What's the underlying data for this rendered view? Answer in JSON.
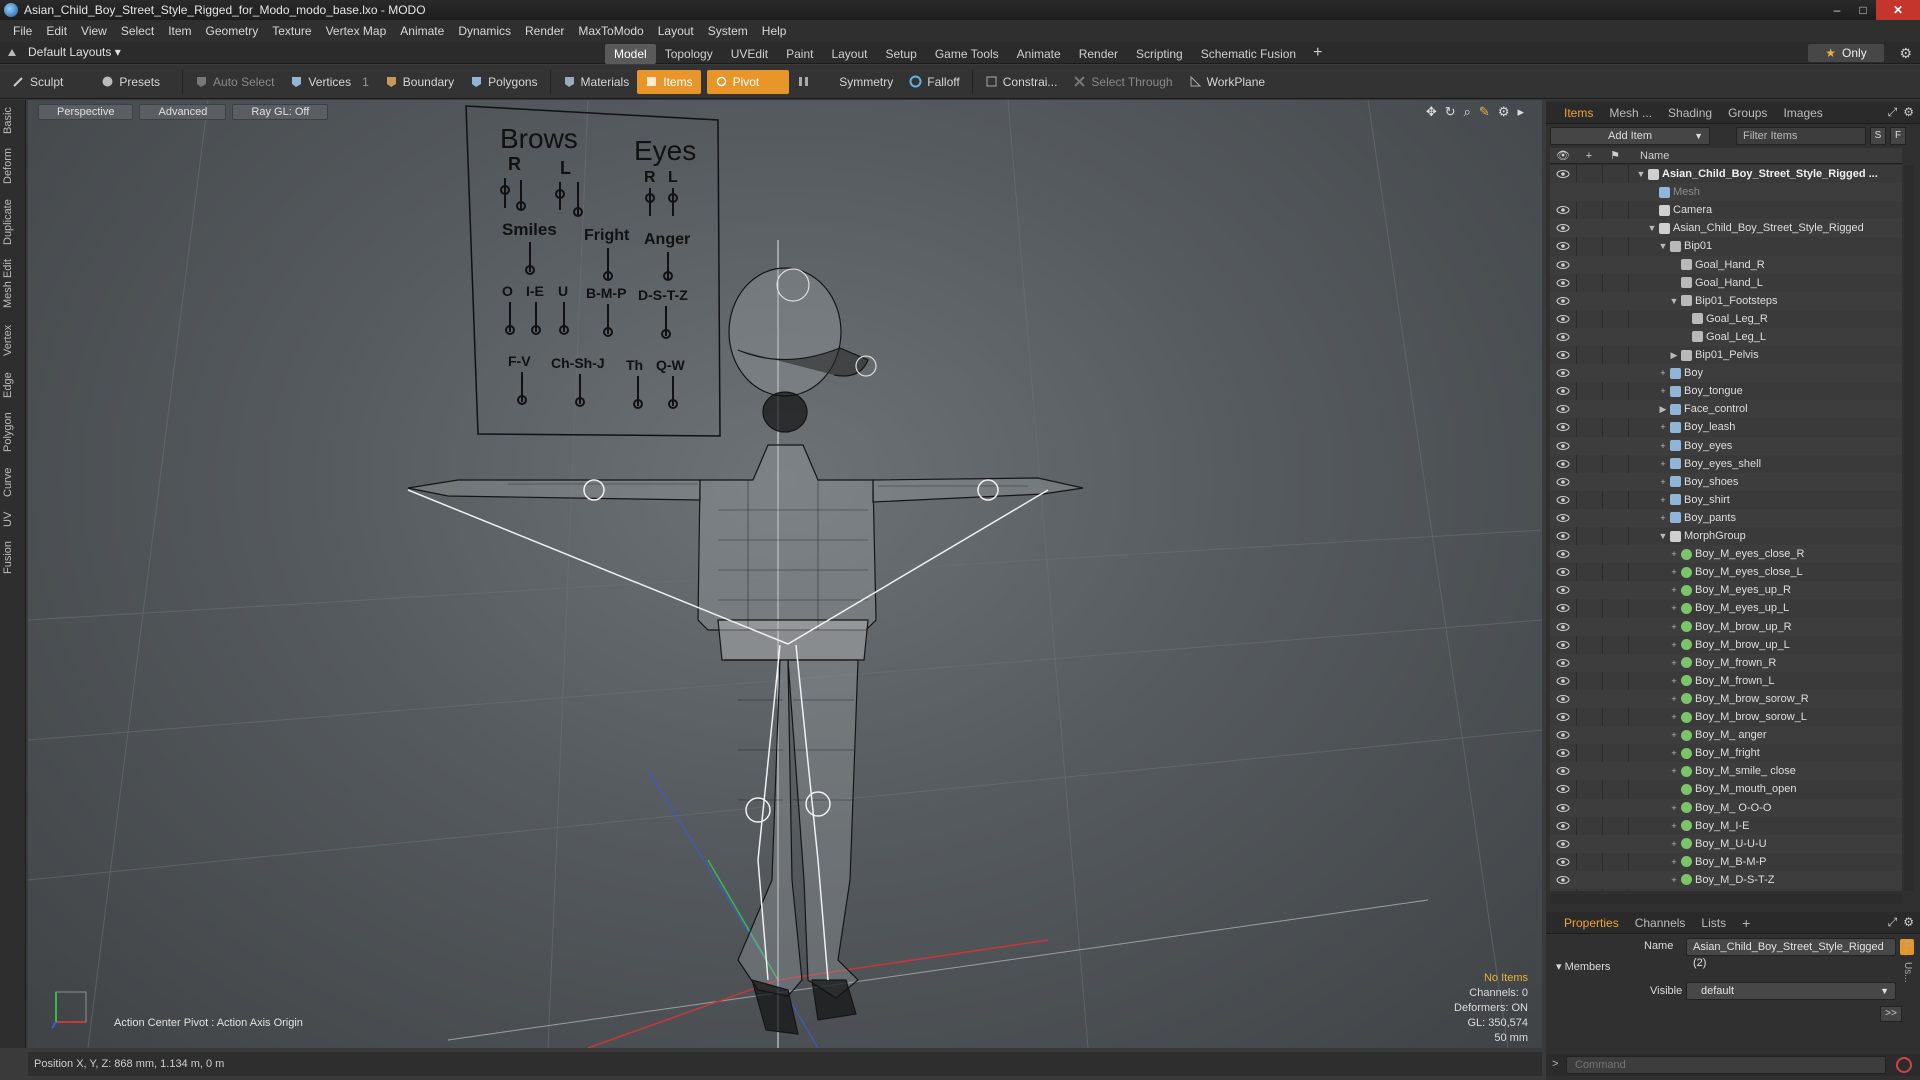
{
  "window": {
    "title": "Asian_Child_Boy_Street_Style_Rigged_for_Modo_modo_base.lxo - MODO",
    "minimize": "–",
    "maximize": "□",
    "close": "✕"
  },
  "menu": [
    "File",
    "Edit",
    "View",
    "Select",
    "Item",
    "Geometry",
    "Texture",
    "Vertex Map",
    "Animate",
    "Dynamics",
    "Render",
    "MaxToModo",
    "Layout",
    "System",
    "Help"
  ],
  "layouts": {
    "dropdown": "Default Layouts ▾",
    "tabs": [
      "Model",
      "Topology",
      "UVEdit",
      "Paint",
      "Layout",
      "Setup",
      "Game Tools",
      "Animate",
      "Render",
      "Scripting",
      "Schematic Fusion"
    ],
    "active_tab": "Model",
    "plus": "+",
    "only": "Only"
  },
  "toolbar": {
    "sculpt": "Sculpt",
    "presets": "Presets",
    "auto_select": "Auto Select",
    "vertices": "Vertices",
    "vertices_count": "1",
    "boundary": "Boundary",
    "polygons": "Polygons",
    "materials": "Materials",
    "items": "Items",
    "pivot": "Pivot",
    "symmetry": "Symmetry",
    "falloff": "Falloff",
    "constraints": "Constrai...",
    "select_through": "Select Through",
    "workplane": "WorkPlane"
  },
  "left_tabs": [
    "Basic",
    "Deform",
    "Duplicate",
    "Mesh Edit",
    "Vertex",
    "Edge",
    "Polygon",
    "Curve",
    "UV",
    "Fusion"
  ],
  "viewport": {
    "perspective": "Perspective",
    "advanced": "Advanced",
    "raygl": "Ray GL: Off",
    "action_center": "Action Center Pivot : Action Axis Origin",
    "info": {
      "no_items": "No Items",
      "channels": "Channels: 0",
      "deformers": "Deformers: ON",
      "gl": "GL: 350,574",
      "focal": "50 mm"
    },
    "board": {
      "brows": "Brows",
      "eyes": "Eyes",
      "r1": "R",
      "l1": "L",
      "r2": "R",
      "l2": "L",
      "smiles": "Smiles",
      "fright": "Fright",
      "anger": "Anger",
      "o": "O",
      "ie": "I-E",
      "u": "U",
      "bmp": "B-M-P",
      "dstz": "D-S-T-Z",
      "fv": "F-V",
      "chshj": "Ch-Sh-J",
      "th": "Th",
      "qw": "Q-W"
    }
  },
  "status": {
    "position": "Position X, Y, Z:  868 mm, 1.134 m, 0 m"
  },
  "items_panel": {
    "tabs": [
      "Items",
      "Mesh ...",
      "Shading",
      "Groups",
      "Images"
    ],
    "active_tab": "Items",
    "add_item": "Add Item",
    "filter": "Filter Items",
    "s_btn": "S",
    "f_btn": "F",
    "name_col": "Name",
    "rows": [
      {
        "label": "Asian_Child_Boy_Street_Style_Rigged ...",
        "indent": 0,
        "toggle": "▼",
        "type": "scene",
        "bold": true
      },
      {
        "label": "Mesh",
        "indent": 1,
        "toggle": "",
        "type": "mesh",
        "dim": true
      },
      {
        "label": "Camera",
        "indent": 1,
        "toggle": "",
        "type": "camera"
      },
      {
        "label": "Asian_Child_Boy_Street_Style_Rigged",
        "indent": 1,
        "toggle": "▼",
        "type": "group"
      },
      {
        "label": "Bip01",
        "indent": 2,
        "toggle": "▼",
        "type": "bone"
      },
      {
        "label": "Goal_Hand_R",
        "indent": 3,
        "toggle": "",
        "type": "bone"
      },
      {
        "label": "Goal_Hand_L",
        "indent": 3,
        "toggle": "",
        "type": "bone"
      },
      {
        "label": "Bip01_Footsteps",
        "indent": 3,
        "toggle": "▼",
        "type": "bone"
      },
      {
        "label": "Goal_Leg_R",
        "indent": 4,
        "toggle": "",
        "type": "bone"
      },
      {
        "label": "Goal_Leg_L",
        "indent": 4,
        "toggle": "",
        "type": "bone"
      },
      {
        "label": "Bip01_Pelvis",
        "indent": 3,
        "toggle": "▶",
        "type": "bone"
      },
      {
        "label": "Boy",
        "indent": 2,
        "toggle": "+",
        "type": "mesh"
      },
      {
        "label": "Boy_tongue",
        "indent": 2,
        "toggle": "+",
        "type": "mesh"
      },
      {
        "label": "Face_control",
        "indent": 2,
        "toggle": "▶",
        "type": "mesh"
      },
      {
        "label": "Boy_leash",
        "indent": 2,
        "toggle": "+",
        "type": "mesh"
      },
      {
        "label": "Boy_eyes",
        "indent": 2,
        "toggle": "+",
        "type": "mesh"
      },
      {
        "label": "Boy_eyes_shell",
        "indent": 2,
        "toggle": "+",
        "type": "mesh"
      },
      {
        "label": "Boy_shoes",
        "indent": 2,
        "toggle": "+",
        "type": "mesh"
      },
      {
        "label": "Boy_shirt",
        "indent": 2,
        "toggle": "+",
        "type": "mesh"
      },
      {
        "label": "Boy_pants",
        "indent": 2,
        "toggle": "+",
        "type": "mesh"
      },
      {
        "label": "MorphGroup",
        "indent": 2,
        "toggle": "▼",
        "type": "group"
      },
      {
        "label": "Boy_M_eyes_close_R",
        "indent": 3,
        "toggle": "+",
        "type": "morph"
      },
      {
        "label": "Boy_M_eyes_close_L",
        "indent": 3,
        "toggle": "+",
        "type": "morph"
      },
      {
        "label": "Boy_M_eyes_up_R",
        "indent": 3,
        "toggle": "+",
        "type": "morph"
      },
      {
        "label": "Boy_M_eyes_up_L",
        "indent": 3,
        "toggle": "+",
        "type": "morph"
      },
      {
        "label": "Boy_M_brow_up_R",
        "indent": 3,
        "toggle": "+",
        "type": "morph"
      },
      {
        "label": "Boy_M_brow_up_L",
        "indent": 3,
        "toggle": "+",
        "type": "morph"
      },
      {
        "label": "Boy_M_frown_R",
        "indent": 3,
        "toggle": "+",
        "type": "morph"
      },
      {
        "label": "Boy_M_frown_L",
        "indent": 3,
        "toggle": "+",
        "type": "morph"
      },
      {
        "label": "Boy_M_brow_sorow_R",
        "indent": 3,
        "toggle": "+",
        "type": "morph"
      },
      {
        "label": "Boy_M_brow_sorow_L",
        "indent": 3,
        "toggle": "+",
        "type": "morph"
      },
      {
        "label": "Boy_M_ anger",
        "indent": 3,
        "toggle": "+",
        "type": "morph"
      },
      {
        "label": "Boy_M_fright",
        "indent": 3,
        "toggle": "+",
        "type": "morph"
      },
      {
        "label": "Boy_M_smile_ close",
        "indent": 3,
        "toggle": "+",
        "type": "morph"
      },
      {
        "label": "Boy_M_mouth_open",
        "indent": 3,
        "toggle": "",
        "type": "morph"
      },
      {
        "label": "Boy_M_ O-O-O",
        "indent": 3,
        "toggle": "+",
        "type": "morph"
      },
      {
        "label": "Boy_M_I-E",
        "indent": 3,
        "toggle": "+",
        "type": "morph"
      },
      {
        "label": "Boy_M_U-U-U",
        "indent": 3,
        "toggle": "+",
        "type": "morph"
      },
      {
        "label": "Boy_M_B-M-P",
        "indent": 3,
        "toggle": "+",
        "type": "morph"
      },
      {
        "label": "Boy_M_D-S-T-Z",
        "indent": 3,
        "toggle": "+",
        "type": "morph"
      }
    ]
  },
  "properties_panel": {
    "tabs": [
      "Properties",
      "Channels",
      "Lists"
    ],
    "active_tab": "Properties",
    "plus": "+",
    "name_label": "Name",
    "name_value": "Asian_Child_Boy_Street_Style_Rigged (2)",
    "members": "Members",
    "visible_label": "Visible",
    "visible_value": "default",
    "more": ">>"
  },
  "right_vtabs": [
    "G...",
    "Us..."
  ],
  "command": {
    "arrow": ">",
    "placeholder": "Command"
  },
  "colors": {
    "accent": "#e8962a",
    "active_tab_text": "#f0a33a",
    "no_items": "#e7b332",
    "close": "#c6352c"
  }
}
